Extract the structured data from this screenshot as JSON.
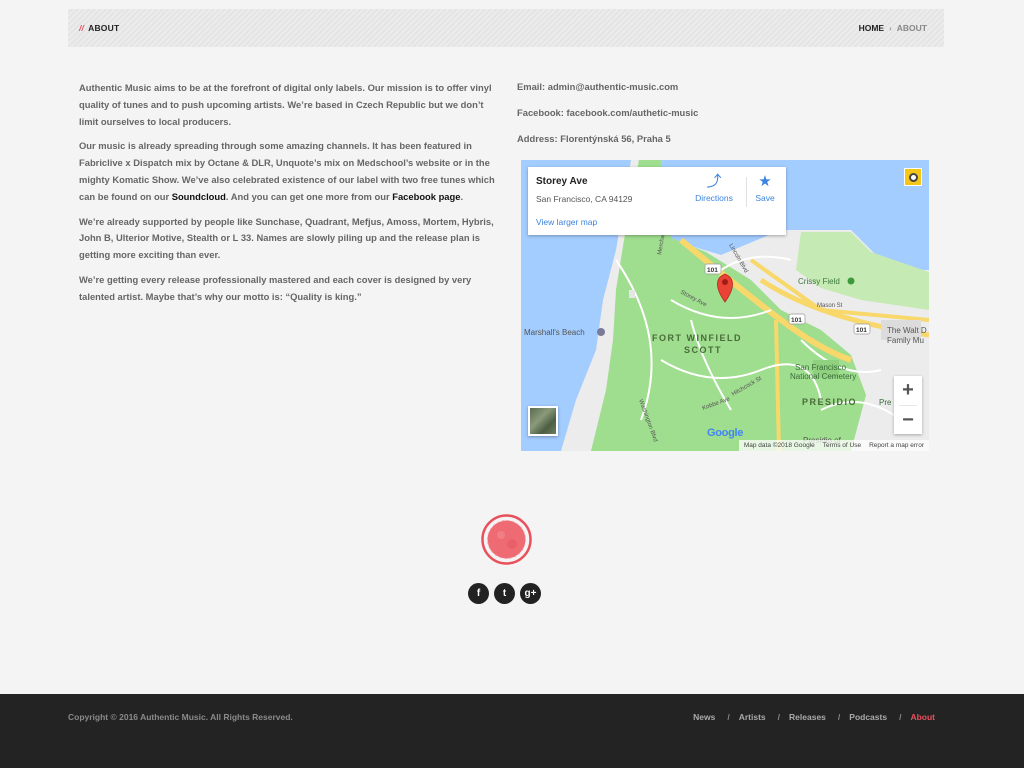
{
  "header": {
    "slashes": "//",
    "title": "ABOUT",
    "breadcrumb": {
      "home": "HOME",
      "separator": "›",
      "current": "ABOUT"
    }
  },
  "about": {
    "p1": "Authentic Music aims to be at the forefront of digital only labels. Our mission is to offer vinyl quality of tunes and to push upcoming artists. We’re based in Czech Republic but we don’t limit ourselves to local producers.",
    "p2_before": "Our music is already spreading through some amazing channels. It has been featured in Fabriclive x Dispatch mix by Octane & DLR, Unquote’s mix on Medschool’s website or in the mighty Komatic Show. We’ve also celebrated existence of our label with two free tunes which can be found on our ",
    "p2_link1": "Soundcloud",
    "p2_middle": ". And you can get one more from our ",
    "p2_link2": "Facebook page",
    "p2_end": ".",
    "p3": "We’re already supported by people like Sunchase, Quadrant, Mefjus, Amoss, Mortem, Hybris, John B, Ulterior Motive, Stealth or L 33. Names are slowly piling up and the release plan is getting more exciting than ever.",
    "p4": "We’re getting every release professionally mastered and each cover is designed by very talented artist. Maybe that’s why our motto is: “Quality is king.”"
  },
  "contact": {
    "email": "Email: admin@authentic-music.com",
    "facebook": "Facebook: facebook.com/authetic-music",
    "address": "Address: Florentýnská 56, Praha 5"
  },
  "map": {
    "place_name": "Storey Ave",
    "place_address": "San Francisco, CA 94129",
    "view_larger": "View larger map",
    "directions": "Directions",
    "save": "Save",
    "zoom_in": "+",
    "zoom_out": "−",
    "labels": {
      "fort1": "FORT WINFIELD",
      "fort2": "SCOTT",
      "presidio": "PRESIDIO",
      "marshalls": "Marshall's Beach",
      "crissy": "Crissy Field",
      "walt1": "The Walt D",
      "walt2": "Family Mu",
      "cemetery1": "San Francisco",
      "cemetery2": "National Cemetery",
      "presidio2": "Presidio of",
      "pre": "Pre",
      "storey": "Storey Ave",
      "mason": "Mason St",
      "lincoln": "Lincoln Blvd",
      "washington": "Washington Blvd",
      "kobbe": "Kobbe Ave",
      "hitchcock": "Hitchcock St",
      "merchant": "Merchant Rd",
      "hwy1": "101",
      "hwy2": "101",
      "hwy3": "101",
      "google": "Google"
    },
    "footer_data": "Map data ©2018 Google",
    "footer_terms": "Terms of Use",
    "footer_report": "Report a map error",
    "colors": {
      "water": "#a3ccff",
      "park": "#9fdd8f",
      "land": "#ececec",
      "highway": "#f8d86a",
      "pin": "#ea4335"
    }
  },
  "social": {
    "facebook": "f",
    "twitter": "t",
    "google": "g+"
  },
  "footer": {
    "copyright": "Copyright © 2016 Authentic Music. All Rights Reserved.",
    "nav": [
      "News",
      "Artists",
      "Releases",
      "Podcasts",
      "About"
    ],
    "separator": "/",
    "accent": "#e8505b"
  }
}
